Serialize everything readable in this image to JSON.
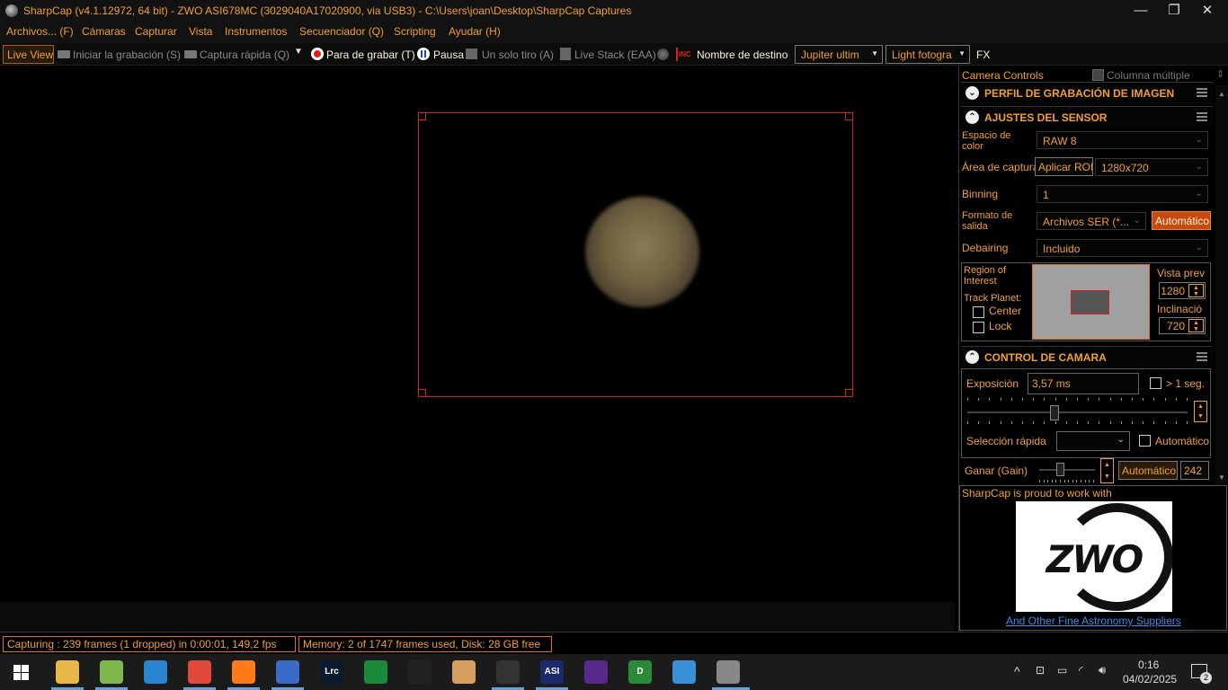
{
  "window": {
    "title": "SharpCap (v4.1.12972, 64 bit) - ZWO ASI678MC (3029040A17020900, via USB3) - C:\\Users\\joan\\Desktop\\SharpCap Captures",
    "minimize": "—",
    "maximize": "❐",
    "close": "✕"
  },
  "menu": [
    "Archivos... (F)",
    "Cámaras",
    "Capturar",
    "Vista",
    "Instrumentos",
    "Secuenciador (Q)",
    "Scripting",
    "Ayudar (H)"
  ],
  "toolbar": {
    "live_view": "Live View",
    "start_recording": "Iniciar la grabación (S)",
    "quick_capture": "Captura rápida (Q)",
    "stop_recording": "Para de grabar (T)",
    "pause": "Pausa",
    "single_shot": "Un solo tiro (A)",
    "live_stack": "Live Stack (EAA)",
    "target_name_label": "Nombre de destino",
    "target_value": "Jupiter ultim",
    "frame_type_value": "Light fotogra",
    "fx": "FX",
    "inc_badge": "INC"
  },
  "panel": {
    "title": "Camera Controls",
    "multi_column": "Columna múltiple",
    "sections": {
      "profile": "PERFIL DE GRABACIÓN DE IMAGEN",
      "sensor": "AJUSTES DEL SENSOR",
      "camera": "CONTROL DE CAMARA"
    },
    "sensor": {
      "color_space_label": "Espacio de color",
      "color_space_value": "RAW 8",
      "capture_area_label": "Área de captura",
      "apply_roi": "Aplicar ROI",
      "resolution_value": "1280x720",
      "binning_label": "Binning",
      "binning_value": "1",
      "output_format_label": "Formato de salida",
      "output_format_value": "Archivos SER (*...",
      "auto_button": "Automático",
      "debayer_label": "Debairing",
      "debayer_value": "Incluido",
      "roi_label": "Region of Interest",
      "track_planet_label": "Track Planet:",
      "center_label": "Center",
      "lock_label": "Lock",
      "preview_width_label": "Vista prev",
      "preview_width_value": "1280",
      "tilt_label": "Inclinació",
      "tilt_value": "720"
    },
    "camera": {
      "exposure_label": "Exposición",
      "exposure_value": "3,57 ms",
      "over_one_sec": "> 1 seg.",
      "quick_select_label": "Selección rápida",
      "auto_label": "Automático",
      "gain_label": "Ganar (Gain)",
      "gain_auto": "Automático",
      "gain_value": "242"
    },
    "sponsor": {
      "text": "SharpCap is proud to work with",
      "logo": "ZWO",
      "link": "And Other Fine Astronomy Suppliers"
    }
  },
  "status": {
    "capturing": "Capturing : 239 frames (1 dropped) in 0:00:01, 149,2 fps",
    "memory": "Memory: 2 of 1747 frames used, Disk: 28 GB free"
  },
  "taskbar": {
    "apps": [
      {
        "name": "explorer-icon",
        "glyph": "",
        "color": "#e8b84a"
      },
      {
        "name": "notepad-icon",
        "glyph": "",
        "color": "#7fb84c"
      },
      {
        "name": "vscode-icon",
        "glyph": "",
        "color": "#2b84d0"
      },
      {
        "name": "chrome-icon",
        "glyph": "",
        "color": "#e04a3a"
      },
      {
        "name": "firefox-icon",
        "glyph": "",
        "color": "#ff7a1a"
      },
      {
        "name": "network-app-icon",
        "glyph": "",
        "color": "#3a6ac8"
      },
      {
        "name": "lightroom-icon",
        "glyph": "Lrc",
        "color": "#0a1b2e"
      },
      {
        "name": "media-app-icon",
        "glyph": "",
        "color": "#1a8a3a"
      },
      {
        "name": "sextant-app-icon",
        "glyph": "",
        "color": "#222222"
      },
      {
        "name": "paint-app-icon",
        "glyph": "",
        "color": "#d8a060"
      },
      {
        "name": "film-app-icon",
        "glyph": "",
        "color": "#333333"
      },
      {
        "name": "asi-studio-icon",
        "glyph": "ASI",
        "color": "#1a2a6a"
      },
      {
        "name": "nebula-app-icon",
        "glyph": "",
        "color": "#5a2a8a"
      },
      {
        "name": "dark-app-icon",
        "glyph": "D",
        "color": "#2a8a3a"
      },
      {
        "name": "photos-icon",
        "glyph": "",
        "color": "#3a90d8"
      },
      {
        "name": "sharpcap-icon",
        "glyph": "",
        "color": "#888888"
      }
    ],
    "time": "0:16",
    "date": "04/02/2025",
    "notifications": "2"
  }
}
